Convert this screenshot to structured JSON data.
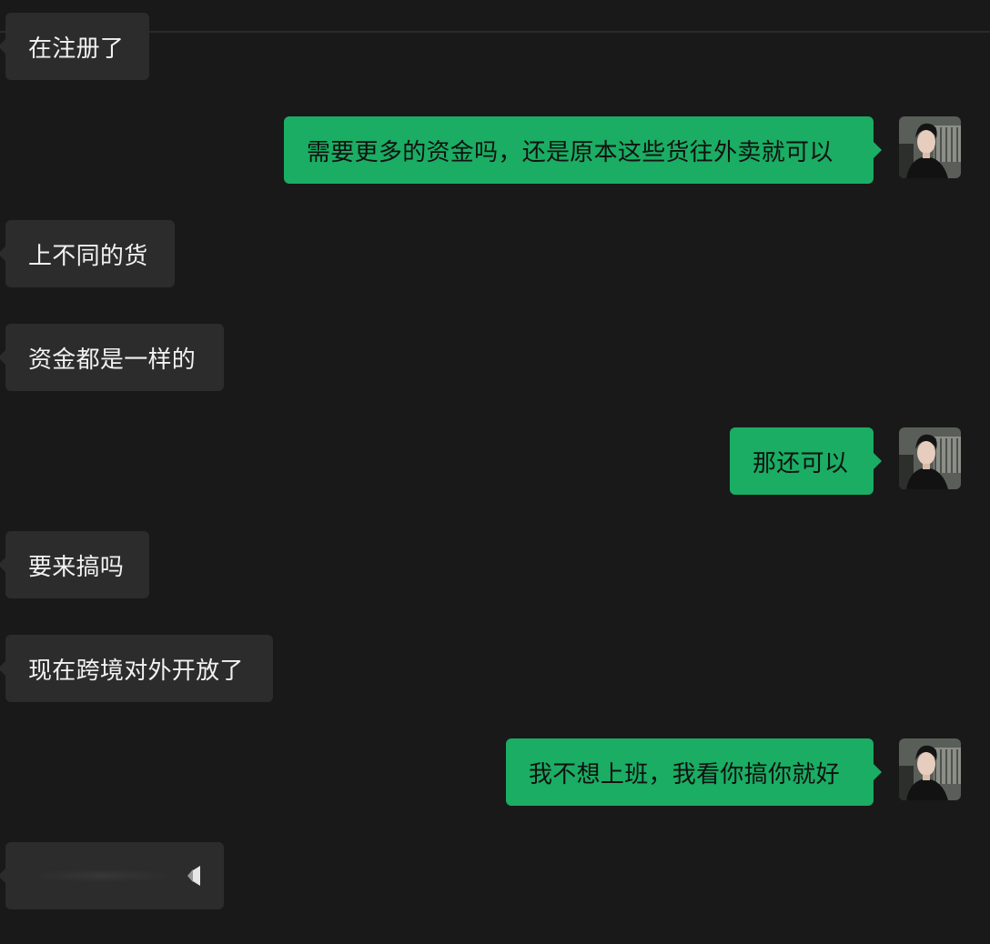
{
  "messages": [
    {
      "direction": "in",
      "text": "在注册了"
    },
    {
      "direction": "out",
      "text": "需要更多的资金吗，还是原本这些货往外卖就可以"
    },
    {
      "direction": "in",
      "text": "上不同的货"
    },
    {
      "direction": "in",
      "text": "资金都是一样的"
    },
    {
      "direction": "out",
      "text": "那还可以"
    },
    {
      "direction": "in",
      "text": "要来搞吗"
    },
    {
      "direction": "in",
      "text": "现在跨境对外开放了"
    },
    {
      "direction": "out",
      "text": "我不想上班，我看你搞你就好"
    },
    {
      "direction": "in",
      "type": "voice",
      "icon": "voice-icon"
    }
  ],
  "colors": {
    "background": "#191919",
    "incoming_bubble": "#2c2c2c",
    "outgoing_bubble": "#1aad63"
  }
}
